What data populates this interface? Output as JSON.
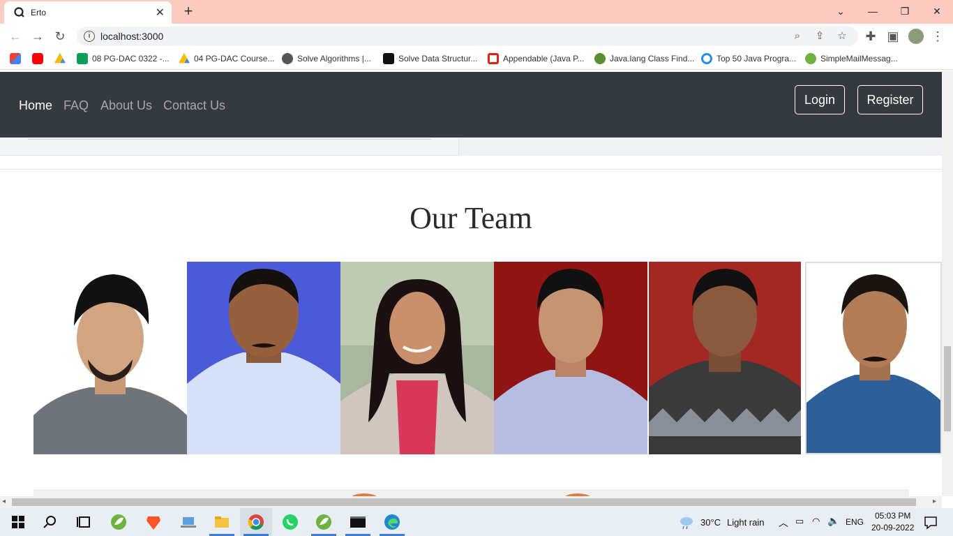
{
  "browser": {
    "tab_title": "Erto",
    "url": "localhost:3000",
    "bookmarks": [
      {
        "label": "",
        "icon": "gmail-icon"
      },
      {
        "label": "",
        "icon": "youtube-icon"
      },
      {
        "label": "",
        "icon": "google-drive-icon"
      },
      {
        "label": "08 PG-DAC 0322 -...",
        "icon": "sheets-icon"
      },
      {
        "label": "04 PG-DAC Course...",
        "icon": "google-drive-icon"
      },
      {
        "label": "Solve Algorithms |...",
        "icon": "globe-icon"
      },
      {
        "label": "Solve Data Structur...",
        "icon": "hackerrank-icon"
      },
      {
        "label": "Appendable (Java P...",
        "icon": "oracle-icon"
      },
      {
        "label": "Java.lang Class Find...",
        "icon": "java-icon"
      },
      {
        "label": "Top 50 Java Progra...",
        "icon": "edureka-icon"
      },
      {
        "label": "SimpleMailMessag...",
        "icon": "spring-icon"
      }
    ]
  },
  "navbar": {
    "links": [
      "Home",
      "FAQ",
      "About Us",
      "Contact Us"
    ],
    "login_label": "Login",
    "register_label": "Register"
  },
  "team": {
    "title": "Our Team",
    "photos": [
      {
        "name": "team-photo-1",
        "background": "#ffffff",
        "shirt": "#6f747a"
      },
      {
        "name": "team-photo-2",
        "background": "#4b5bd8",
        "shirt": "#d6e1f7"
      },
      {
        "name": "team-photo-3",
        "background": "#a9b7a0",
        "shirt": "#cfc7bd"
      },
      {
        "name": "team-photo-4",
        "background": "#8f1414",
        "shirt": "#b7bde0"
      },
      {
        "name": "team-photo-5",
        "background": "#a32722",
        "shirt": "#3a3a3a"
      },
      {
        "name": "team-photo-6",
        "background": "#ffffff",
        "shirt": "#2f5f99"
      }
    ]
  },
  "taskbar": {
    "weather_temp": "30°C",
    "weather_desc": "Light rain",
    "language": "ENG",
    "time": "05:03 PM",
    "date": "20-09-2022"
  }
}
